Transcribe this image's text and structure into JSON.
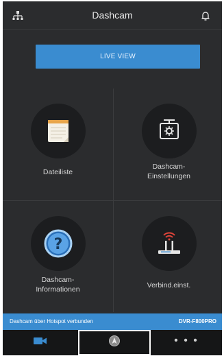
{
  "header": {
    "title": "Dashcam",
    "left_icon": "network-tree-icon",
    "right_icon": "bell-icon"
  },
  "live_view": {
    "label": "LIVE VIEW"
  },
  "tiles": [
    {
      "label": "Dateiliste",
      "icon": "notepad-icon"
    },
    {
      "label_line1": "Dashcam-",
      "label_line2": "Einstellungen",
      "icon": "dashcam-settings-icon"
    },
    {
      "label_line1": "Dashcam-",
      "label_line2": "Informationen",
      "icon": "question-icon"
    },
    {
      "label": "Verbind.einst.",
      "icon": "wifi-router-icon"
    }
  ],
  "status": {
    "message": "Dashcam über Hotspot verbunden",
    "device": "DVR-F800PRO"
  },
  "bottom_nav": {
    "items": [
      {
        "icon": "video-camera-icon"
      },
      {
        "icon": "navigation-icon"
      },
      {
        "label": "• • •",
        "icon": "more-icon"
      }
    ]
  },
  "colors": {
    "accent": "#3a8cd0",
    "background": "#2b2c2e",
    "nav_background": "#151617"
  }
}
